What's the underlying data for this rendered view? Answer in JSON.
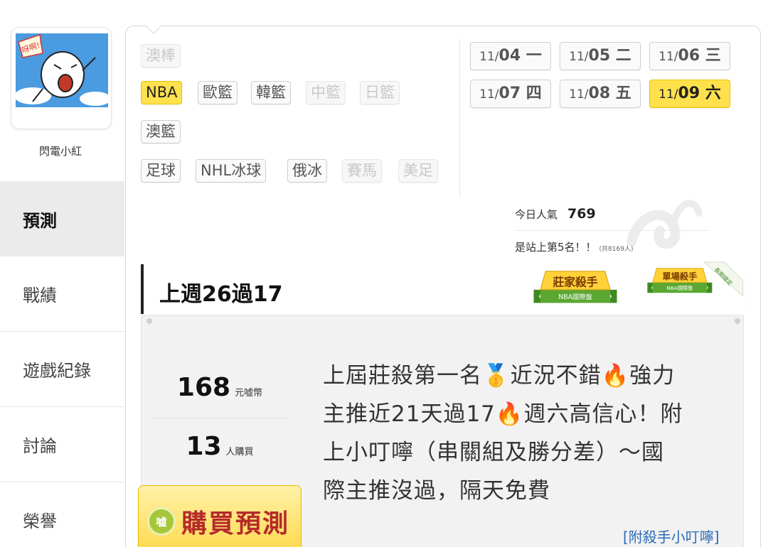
{
  "user": {
    "name": "閃電小紅",
    "avatar_text": "呀啊!!"
  },
  "nav": [
    {
      "label": "預測",
      "active": true
    },
    {
      "label": "戰績",
      "active": false
    },
    {
      "label": "遊戲紀錄",
      "active": false
    },
    {
      "label": "討論",
      "active": false
    },
    {
      "label": "榮譽",
      "active": false
    }
  ],
  "categories": {
    "row1": [
      {
        "label": "澳棒",
        "state": "disabled"
      }
    ],
    "row2": [
      {
        "label": "NBA",
        "state": "active"
      },
      {
        "label": "歐籃",
        "state": "normal"
      },
      {
        "label": "韓籃",
        "state": "normal"
      },
      {
        "label": "中籃",
        "state": "disabled"
      },
      {
        "label": "日籃",
        "state": "disabled"
      }
    ],
    "row3": [
      {
        "label": "澳籃",
        "state": "normal"
      }
    ],
    "row4": [
      {
        "label": "足球",
        "state": "normal"
      },
      {
        "label": "NHL冰球",
        "state": "normal"
      },
      {
        "label": "俄冰",
        "state": "normal"
      },
      {
        "label": "賽馬",
        "state": "disabled"
      },
      {
        "label": "美足",
        "state": "disabled"
      }
    ]
  },
  "dates": [
    {
      "md": "11/",
      "d": "04 一",
      "active": false
    },
    {
      "md": "11/",
      "d": "05 二",
      "active": false
    },
    {
      "md": "11/",
      "d": "06 三",
      "active": false
    },
    {
      "md": "11/",
      "d": "07 四",
      "active": false
    },
    {
      "md": "11/",
      "d": "08 五",
      "active": false
    },
    {
      "md": "11/",
      "d": "09 六",
      "active": true
    }
  ],
  "popularity": {
    "label": "今日人氣",
    "value": "769"
  },
  "rank": {
    "text": "是站上第5名！！",
    "total": "(共8169人)"
  },
  "record": {
    "text": "上週26過17"
  },
  "badges": [
    {
      "title": "莊家殺手",
      "subtitle": "NBA國際盤"
    },
    {
      "title": "單場殺手",
      "subtitle": "NBA國際盤",
      "ribbon": "長期穩定"
    }
  ],
  "price": {
    "value": "168",
    "unit": "元嘘幣"
  },
  "buyers": {
    "value": "13",
    "unit": "人購買"
  },
  "buy_button": {
    "label": "購買預測",
    "coin": "嘘"
  },
  "description": {
    "line1a": "上屆莊殺第一名",
    "line1b": "近況不錯",
    "line1c": "強力",
    "line2a": "主推近21天過17",
    "line2b": "週六高信心！附",
    "line3": "上小叮嚀（串關組及勝分差）～國",
    "line4": "際主推沒過，隔天免費"
  },
  "link": {
    "label": "[附殺手小叮嚀]"
  },
  "colors": {
    "active_yellow": "#ffe14d",
    "link_blue": "#2a6bb8",
    "badge_green": "#5aa832",
    "buy_red": "#b52a2a"
  }
}
